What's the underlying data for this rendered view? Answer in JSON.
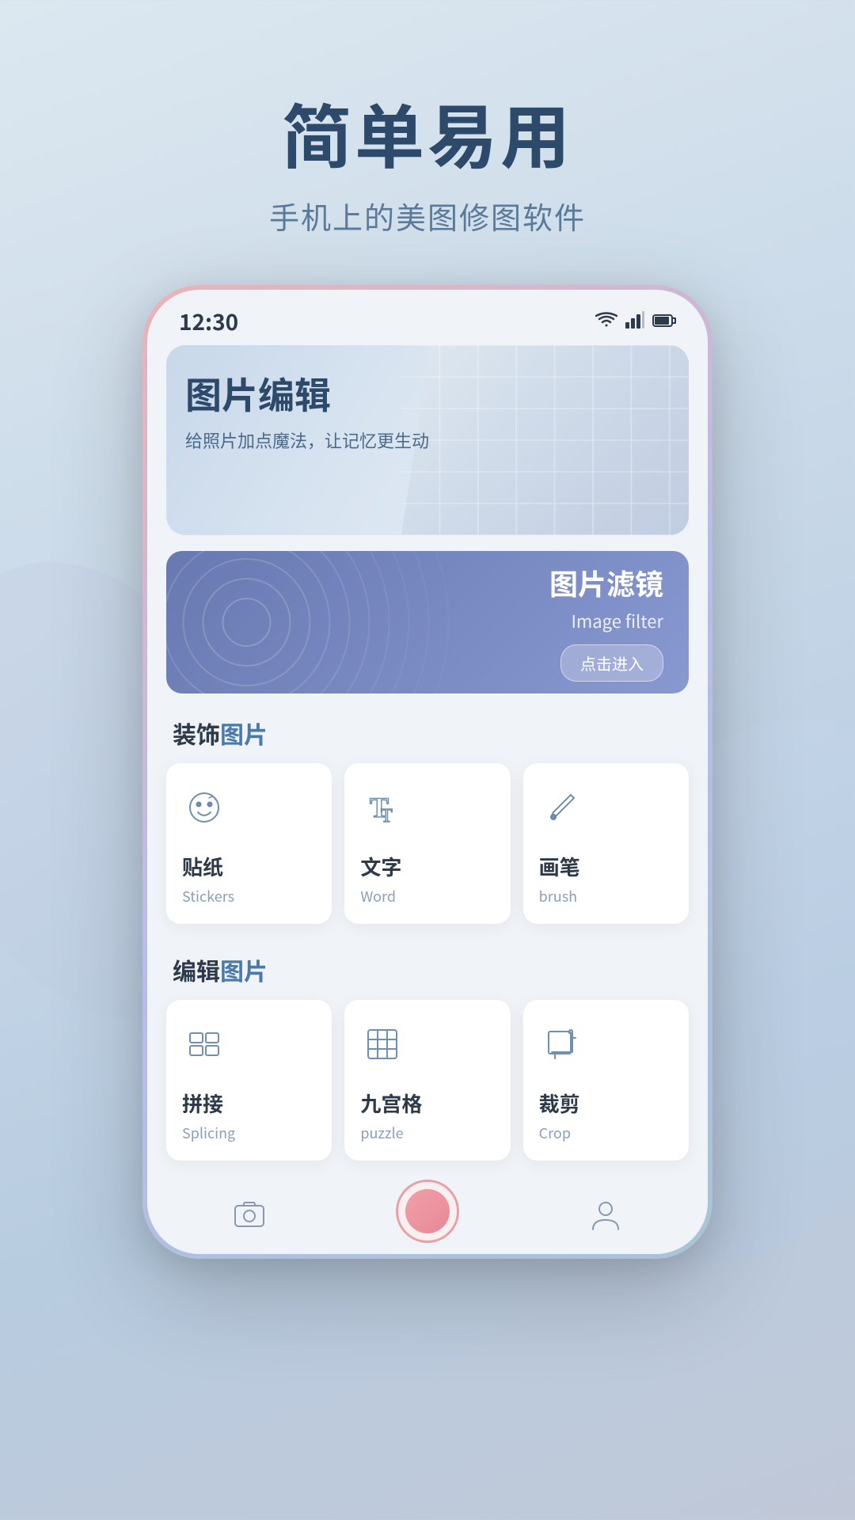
{
  "app": {
    "background_gradient_start": "#dce8f0",
    "background_gradient_end": "#c0c8d8"
  },
  "header": {
    "main_title": "简单易用",
    "sub_title": "手机上的美图修图软件"
  },
  "phone": {
    "status_bar": {
      "time": "12:30",
      "wifi_icon": "wifi",
      "signal_icon": "signal",
      "battery_icon": "battery"
    },
    "hero": {
      "main_text": "图片编辑",
      "sub_text": "给照片加点魔法，让记忆更生动"
    },
    "filter_card": {
      "title_cn": "图片滤镜",
      "title_en": "Image filter",
      "button_label": "点击进入"
    },
    "decorate_section": {
      "header": "装饰图片",
      "header_highlight": "图片",
      "tools": [
        {
          "name_cn": "贴纸",
          "name_en": "Stickers",
          "icon": "sticker"
        },
        {
          "name_cn": "文字",
          "name_en": "Word",
          "icon": "text"
        },
        {
          "name_cn": "画笔",
          "name_en": "brush",
          "icon": "brush"
        }
      ]
    },
    "edit_section": {
      "header": "编辑图片",
      "header_highlight": "图片",
      "tools": [
        {
          "name_cn": "拼接",
          "name_en": "Splicing",
          "icon": "splicing"
        },
        {
          "name_cn": "九宫格",
          "name_en": "puzzle",
          "icon": "puzzle"
        },
        {
          "name_cn": "裁剪",
          "name_en": "Crop",
          "icon": "crop"
        }
      ]
    },
    "bottom_nav": {
      "items": [
        {
          "icon": "photo",
          "label": ""
        },
        {
          "icon": "camera",
          "label": ""
        },
        {
          "icon": "person",
          "label": ""
        }
      ]
    }
  }
}
